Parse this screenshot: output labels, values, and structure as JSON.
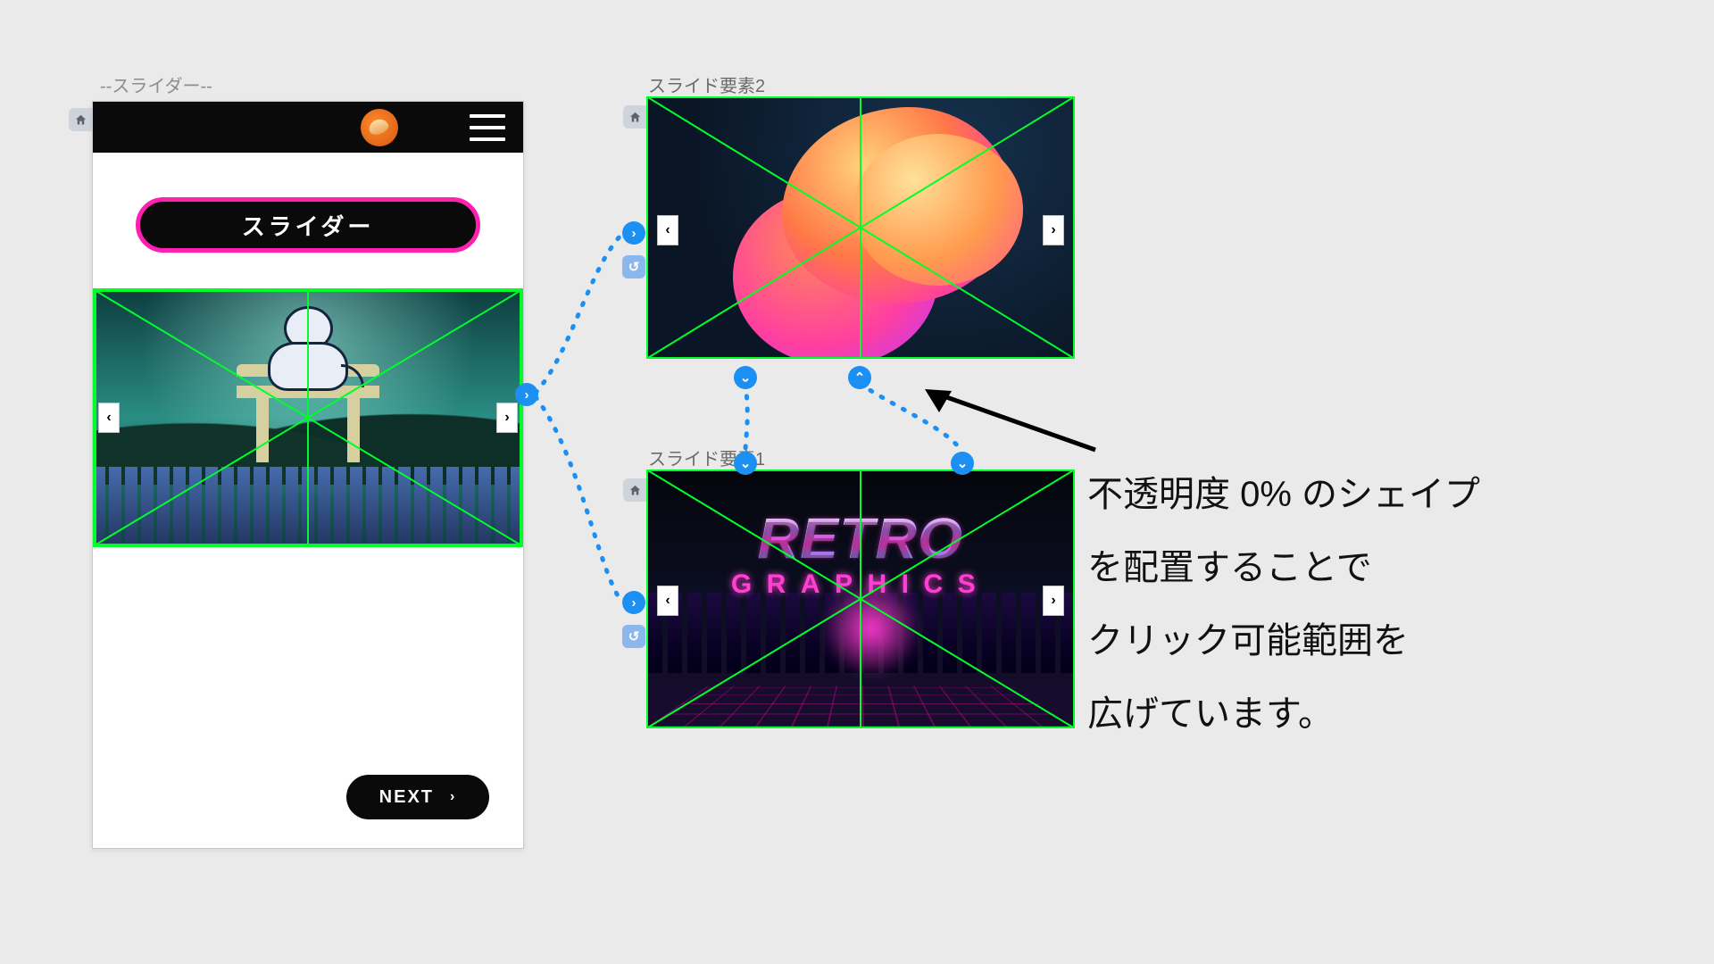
{
  "labels": {
    "slider_frame": "--スライダー--",
    "slide_el2": "スライド要素2",
    "slide_el1": "スライド要素1"
  },
  "phone": {
    "pill_label": "スライダー",
    "prev_glyph": "‹",
    "next_glyph": "›",
    "next_button": "NEXT",
    "next_chevron": "›"
  },
  "element_panels": {
    "el2": {
      "prev_glyph": "‹",
      "next_glyph": "›"
    },
    "el1": {
      "prev_glyph": "‹",
      "next_glyph": "›",
      "word1": "RETRO",
      "word2": "GRAPHICS"
    }
  },
  "annotation": {
    "line1": "不透明度 0% のシェイプ",
    "line2": "を配置することで",
    "line3": "クリック可能範囲を",
    "line4": "広げています。"
  },
  "hub_glyphs": {
    "right": "›",
    "left": "‹",
    "down": "⌄",
    "up": "⌃",
    "undo": "↺"
  }
}
